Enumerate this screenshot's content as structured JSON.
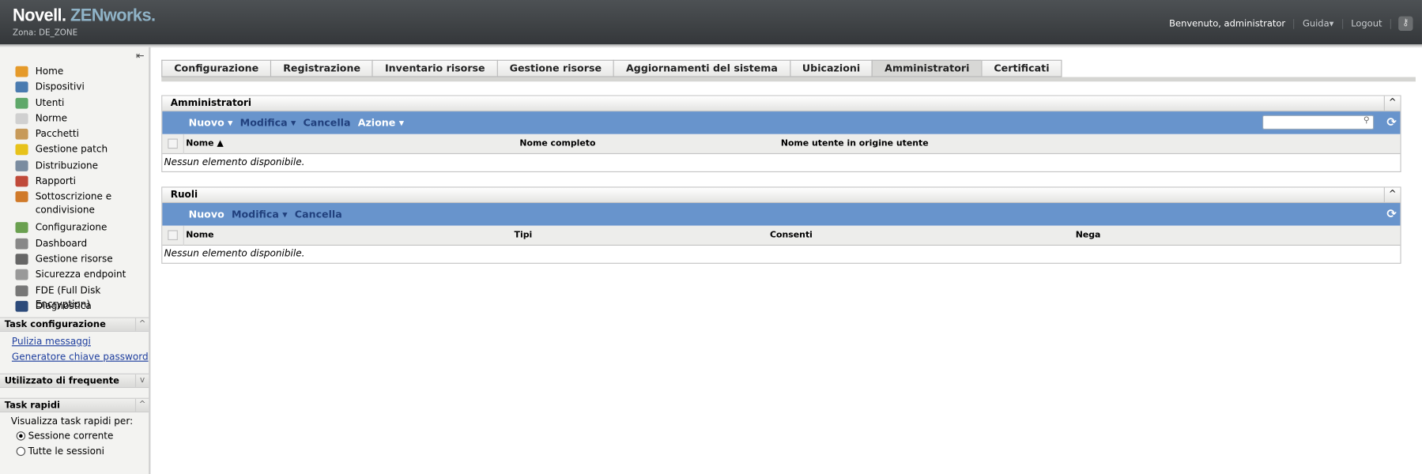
{
  "header": {
    "brand": "Novell.",
    "product": "ZENworks.",
    "zone": "Zona: DE_ZONE",
    "welcome": "Benvenuto, administrator",
    "help": "Guida▾",
    "logout": "Logout",
    "key_icon": "key-icon"
  },
  "sidebar": {
    "collapse": "⇤",
    "items": [
      {
        "label": "Home",
        "color": "#e59a2a"
      },
      {
        "label": "Dispositivi",
        "color": "#4a7bb0"
      },
      {
        "label": "Utenti",
        "color": "#5fa86a"
      },
      {
        "label": "Norme",
        "color": "#d0d0d0"
      },
      {
        "label": "Pacchetti",
        "color": "#c79a5a"
      },
      {
        "label": "Gestione patch",
        "color": "#e7c21a"
      },
      {
        "label": "Distribuzione",
        "color": "#7a8ca0"
      },
      {
        "label": "Rapporti",
        "color": "#c04a3a"
      },
      {
        "label": "Sottoscrizione e",
        "label2": "condivisione",
        "color": "#d07a2a"
      },
      {
        "label": "Configurazione",
        "color": "#6aa050"
      },
      {
        "label": "Dashboard",
        "color": "#888"
      },
      {
        "label": "Gestione risorse",
        "color": "#666"
      },
      {
        "label": "Sicurezza endpoint",
        "color": "#999"
      },
      {
        "label": "FDE (Full Disk Encryption)",
        "color": "#777"
      },
      {
        "label": "Diagnostica",
        "color": "#2c4a7a"
      }
    ],
    "task_config": {
      "title": "Task configurazione",
      "links": [
        "Pulizia messaggi",
        "Generatore chiave password"
      ]
    },
    "frequent": {
      "title": "Utilizzato di frequente"
    },
    "quick": {
      "title": "Task rapidi",
      "label": "Visualizza task rapidi per:",
      "options": [
        "Sessione corrente",
        "Tutte le sessioni"
      ],
      "selected": 0
    }
  },
  "tabs": [
    "Configurazione",
    "Registrazione",
    "Inventario risorse",
    "Gestione risorse",
    "Aggiornamenti del sistema",
    "Ubicazioni",
    "Amministratori",
    "Certificati"
  ],
  "active_tab": "Amministratori",
  "admins": {
    "title": "Amministratori",
    "toolbar": [
      "Nuovo ▾",
      "Modifica ▾",
      "Cancella",
      "Azione ▾"
    ],
    "search_placeholder": "",
    "columns": [
      "Nome ▲",
      "Nome completo",
      "Nome utente in origine utente"
    ],
    "empty": "Nessun elemento disponibile."
  },
  "roles": {
    "title": "Ruoli",
    "toolbar": [
      "Nuovo",
      "Modifica ▾",
      "Cancella"
    ],
    "columns": [
      "Nome",
      "Tipi",
      "Consenti",
      "Nega"
    ],
    "empty": "Nessun elemento disponibile."
  }
}
